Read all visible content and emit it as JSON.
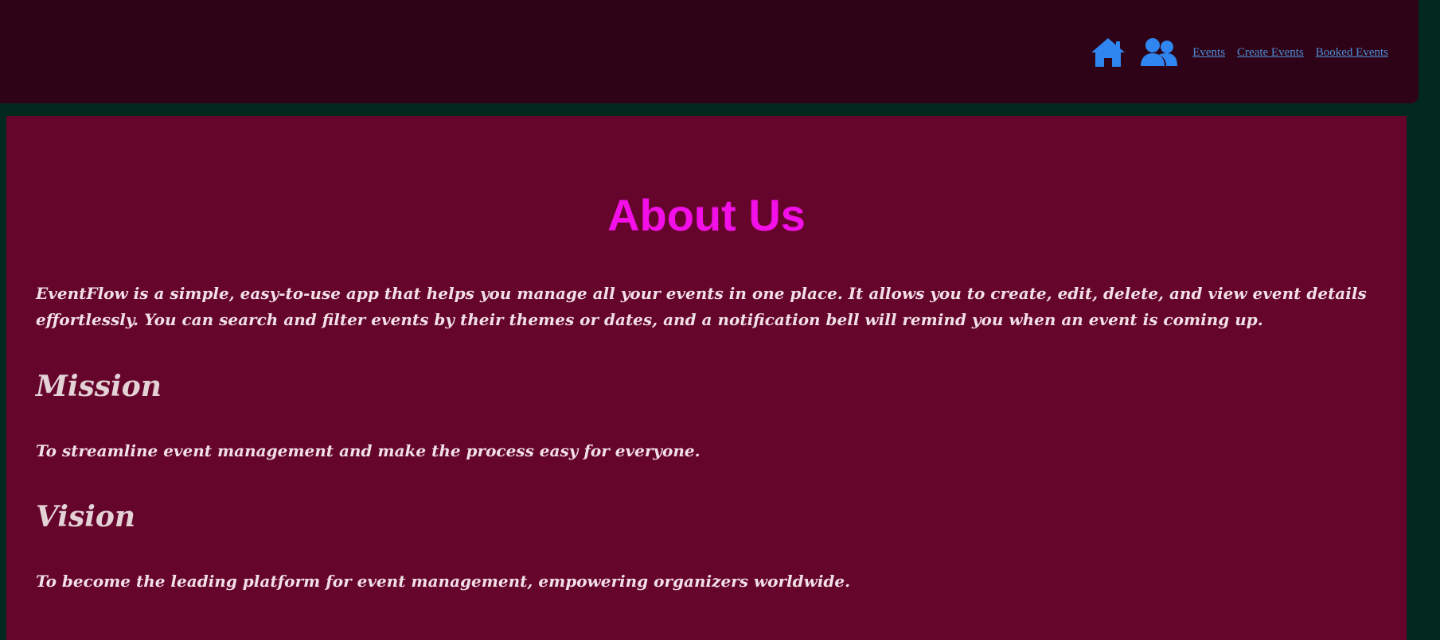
{
  "colors": {
    "page_background": "#03281d",
    "header_background": "#2e0217",
    "content_background": "#66052b",
    "title_color": "#f20fe8",
    "text_color": "#f1e0e6",
    "link_color": "#4d8fd6"
  },
  "header": {
    "icons": [
      "home-icon",
      "users-icon"
    ],
    "links": [
      "Events",
      "Create Events",
      "Booked Events"
    ]
  },
  "main": {
    "title": "About Us",
    "intro": "EventFlow is a simple, easy-to-use app that helps you manage all your events in one place. It allows you to create, edit, delete, and view event details effortlessly. You can search and filter events by their themes or dates, and a notification bell will remind you when an event is coming up.",
    "mission": {
      "heading": "Mission",
      "text": "To streamline event management and make the process easy for everyone."
    },
    "vision": {
      "heading": "Vision",
      "text": "To become the leading platform for event management, empowering organizers worldwide."
    }
  }
}
